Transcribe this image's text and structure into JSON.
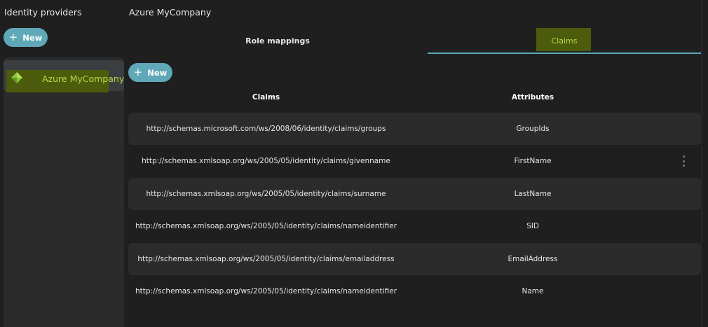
{
  "sidebar": {
    "title": "Identity providers",
    "new_label": "New",
    "providers": [
      {
        "label": "Azure MyCompany",
        "icon": "azure-diamond-icon"
      }
    ]
  },
  "main": {
    "title": "Azure MyCompany",
    "tabs": [
      {
        "label": "Role mappings",
        "active": false
      },
      {
        "label": "Claims",
        "active": true
      }
    ],
    "new_label": "New",
    "columns": {
      "claims": "Claims",
      "attributes": "Attributes"
    },
    "rows": [
      {
        "claim": "http://schemas.microsoft.com/ws/2008/06/identity/claims/groups",
        "attribute": "GroupIds"
      },
      {
        "claim": "http://schemas.xmlsoap.org/ws/2005/05/identity/claims/givenname",
        "attribute": "FirstName"
      },
      {
        "claim": "http://schemas.xmlsoap.org/ws/2005/05/identity/claims/surname",
        "attribute": "LastName"
      },
      {
        "claim": "http://schemas.xmlsoap.org/ws/2005/05/identity/claims/nameidentifier",
        "attribute": "SID"
      },
      {
        "claim": "http://schemas.xmlsoap.org/ws/2005/05/identity/claims/emailaddress",
        "attribute": "EmailAddress"
      },
      {
        "claim": "http://schemas.xmlsoap.org/ws/2005/05/identity/claims/nameidentifier",
        "attribute": "Name"
      }
    ]
  },
  "colors": {
    "background": "#1f1f1f",
    "panel": "#2b2b2b",
    "accent_teal": "#5fa8b8",
    "highlight_green": "#b9d84a",
    "highlight_bg": "#4d5b0c"
  }
}
